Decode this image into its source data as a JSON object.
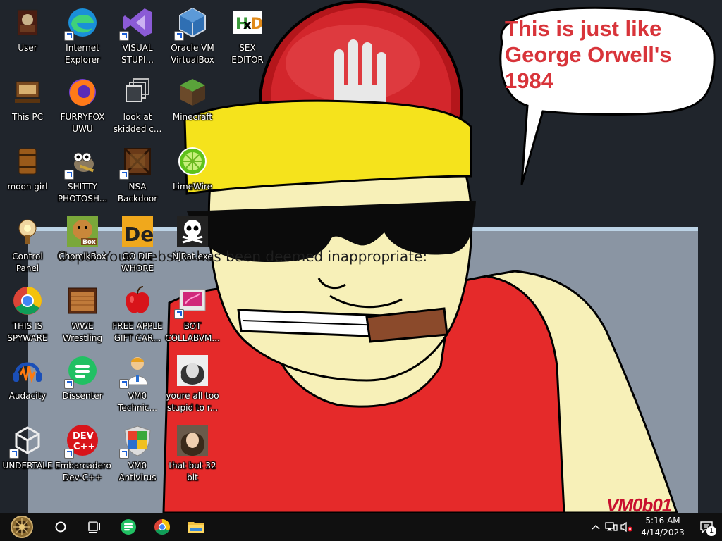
{
  "desktop": {
    "icons": [
      {
        "id": "user",
        "label": "User"
      },
      {
        "id": "internet-explorer",
        "label": "Internet\nExplorer"
      },
      {
        "id": "visual-studio",
        "label": "VISUAL\nSTUPI..."
      },
      {
        "id": "virtualbox",
        "label": "Oracle VM\nVirtualBox"
      },
      {
        "id": "sex-editor",
        "label": "SEX\nEDITOR"
      },
      {
        "id": "this-pc",
        "label": "This PC"
      },
      {
        "id": "furryfox",
        "label": "FURRYFOX\nUWU"
      },
      {
        "id": "skidded",
        "label": "look at\nskidded c..."
      },
      {
        "id": "minecraft",
        "label": "Minecraft"
      },
      {
        "id": "moon-girl",
        "label": "moon girl"
      },
      {
        "id": "shitty-photoshop",
        "label": "SHITTY\nPHOTOSH..."
      },
      {
        "id": "nsa-backdoor",
        "label": "NSA\nBackdoor"
      },
      {
        "id": "limewire",
        "label": "LimeWire"
      },
      {
        "id": "control-panel",
        "label": "Control Panel"
      },
      {
        "id": "chomikbox",
        "label": "ChomikBox"
      },
      {
        "id": "go-die",
        "label": "GO DIE\nWHORE"
      },
      {
        "id": "njrat",
        "label": "NjRat.exe"
      },
      {
        "id": "spyware",
        "label": "THIS IS\nSPYWARE"
      },
      {
        "id": "wwe",
        "label": "WWE\nWrestling"
      },
      {
        "id": "apple-gift",
        "label": "FREE APPLE\nGIFT CAR..."
      },
      {
        "id": "bot-collab",
        "label": "BOT\nCOLLABVM..."
      },
      {
        "id": "audacity",
        "label": "Audacity"
      },
      {
        "id": "dissenter",
        "label": "Dissenter"
      },
      {
        "id": "vm0-technician",
        "label": "VM0\nTechnic..."
      },
      {
        "id": "stupid",
        "label": "youre all too\nstupid to r..."
      },
      {
        "id": "undertale",
        "label": "UNDERTALE"
      },
      {
        "id": "devcpp",
        "label": "Embarcadero\nDev-C++"
      },
      {
        "id": "vm0-antivirus",
        "label": "VM0\nAntivirus"
      },
      {
        "id": "32bit",
        "label": "that but 32\nbit"
      }
    ]
  },
  "wallpaper": {
    "speech_bubble": "This is just like George Orwell's 1984",
    "dialog_text": "Oops! Your website has been deemed inappropriate:",
    "watermark": "VM0b01"
  },
  "taskbar": {
    "buttons": [
      {
        "id": "start",
        "icon": "start-orb-icon"
      },
      {
        "id": "search",
        "icon": "cortana-circle-icon"
      },
      {
        "id": "task-view",
        "icon": "task-view-icon"
      },
      {
        "id": "dissenter",
        "icon": "dissenter-icon"
      },
      {
        "id": "chrome",
        "icon": "chrome-icon"
      },
      {
        "id": "explorer",
        "icon": "folder-icon"
      }
    ],
    "tray": {
      "time": "5:16 AM",
      "date": "4/14/2023",
      "notification_count": "1"
    }
  },
  "colors": {
    "speech_text": "#d8343a",
    "hat": "#f5e31c",
    "shirt": "#e52a2a",
    "skin": "#f7f0b8",
    "taskbar": "#101010"
  }
}
